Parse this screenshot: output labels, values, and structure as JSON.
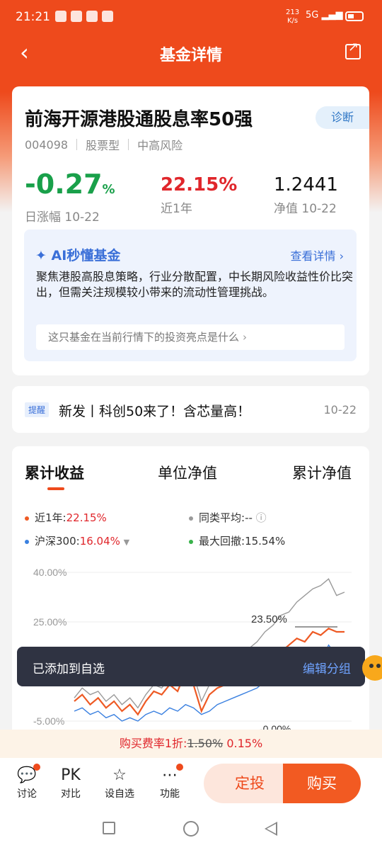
{
  "status": {
    "time": "21:21",
    "speed_top": "213",
    "speed_bottom": "K/s",
    "signal": "5G"
  },
  "nav": {
    "back": "‹",
    "title": "基金详情"
  },
  "fund": {
    "name": "前海开源港股通股息率50强",
    "diagnose": "诊断",
    "code": "004098",
    "type": "股票型",
    "risk": "中高风险",
    "daily_change": "-0.27",
    "daily_change_unit": "%",
    "daily_label": "日涨幅 10-22",
    "year_return": "22.15%",
    "year_label": "近1年",
    "nav_value": "1.2441",
    "nav_label": "净值 10-22"
  },
  "ai": {
    "title": "AI秒懂基金",
    "more": "查看详情 ›",
    "summary": "聚焦港股高股息策略，行业分散配置，中长期风险收益性价比突出，但需关注规模较小带来的流动性管理挑战。",
    "question": "这只基金在当前行情下的投资亮点是什么",
    "question_chevron": "›"
  },
  "notice": {
    "tag": "提醒",
    "text": "新发丨科创50来了！含芯量高！",
    "date": "10-22"
  },
  "chart_tabs": [
    "累计收益",
    "单位净值",
    "累计净值"
  ],
  "legend": {
    "fund_label": "近1年:",
    "fund_value": "22.15%",
    "peer_label": "同类平均:",
    "peer_value": "--",
    "index_label": "沪深300:",
    "index_value": "16.04%",
    "drawdown_label": "最大回撤:",
    "drawdown_value": "15.54%"
  },
  "colors": {
    "fund": "#ee5a24",
    "peer": "#9a9a9a",
    "index": "#3a80e0",
    "drawdown": "#38b24a"
  },
  "chart_data": {
    "type": "line",
    "ylim": [
      -5,
      40
    ],
    "y_ticks": [
      "40.00%",
      "25.00%",
      "-5.00%"
    ],
    "annotations": [
      "23.50%",
      "-0.00%"
    ],
    "series": [
      {
        "name": "近1年",
        "values": [
          1,
          3,
          0,
          2,
          -1,
          1,
          -2,
          0,
          -3,
          1,
          4,
          3,
          6,
          4,
          10,
          6,
          -2,
          3,
          5,
          6,
          8,
          10,
          9,
          12,
          14,
          13,
          16,
          18,
          20,
          19,
          22,
          21,
          23,
          22,
          22
        ]
      },
      {
        "name": "同类平均",
        "values": [
          2,
          5,
          3,
          4,
          1,
          3,
          0,
          2,
          -1,
          3,
          6,
          5,
          8,
          7,
          12,
          9,
          1,
          6,
          9,
          11,
          14,
          16,
          17,
          19,
          22,
          24,
          27,
          28,
          31,
          33,
          35,
          36,
          38,
          33,
          34
        ]
      },
      {
        "name": "沪深300",
        "values": [
          -2,
          -1,
          -3,
          -2,
          -4,
          -3,
          -5,
          -4,
          -5,
          -3,
          -2,
          -3,
          -1,
          -2,
          0,
          -1,
          -3,
          -2,
          0,
          1,
          2,
          3,
          4,
          5,
          7,
          8,
          9,
          10,
          12,
          14,
          16,
          13,
          18,
          15,
          16
        ]
      }
    ]
  },
  "toast": {
    "message": "已添加到自选",
    "action": "编辑分组"
  },
  "fee": {
    "prefix": "购买费率1折:",
    "original": "1.50%",
    "discount": "0.15%"
  },
  "bottom": {
    "discuss": "讨论",
    "pk": "PK",
    "compare": "对比",
    "watch": "设自选",
    "func": "功能",
    "sip": "定投",
    "buy": "购买"
  }
}
